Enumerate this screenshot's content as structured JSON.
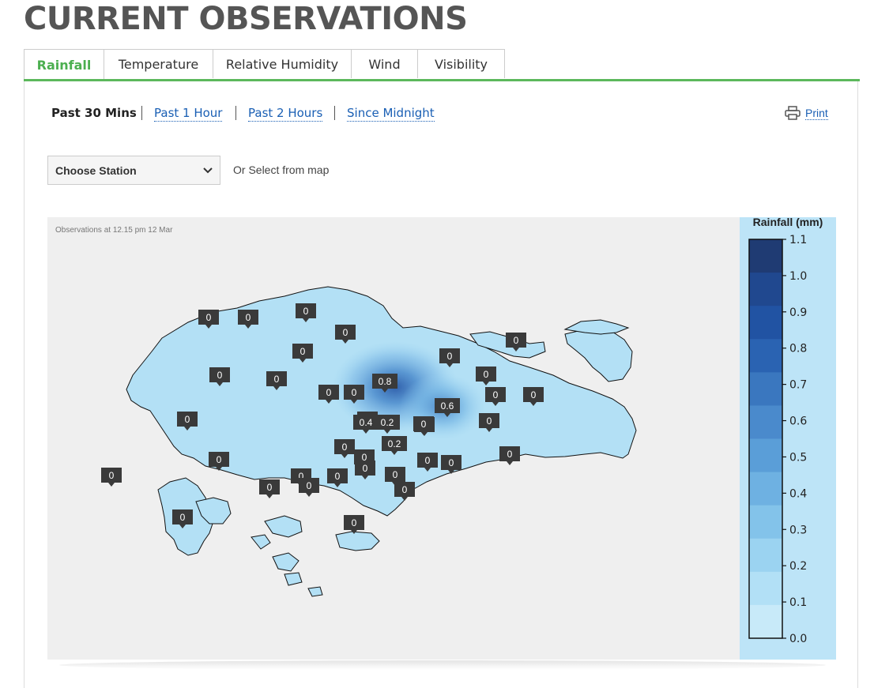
{
  "page": {
    "title": "CURRENT OBSERVATIONS"
  },
  "tabs": [
    {
      "label": "Rainfall",
      "active": true
    },
    {
      "label": "Temperature"
    },
    {
      "label": "Relative Humidity"
    },
    {
      "label": "Wind"
    },
    {
      "label": "Visibility"
    }
  ],
  "periods": [
    {
      "label": "Past 30 Mins",
      "active": true
    },
    {
      "label": "Past 1 Hour"
    },
    {
      "label": "Past 2 Hours"
    },
    {
      "label": "Since Midnight"
    }
  ],
  "print_label": "Print",
  "station_select": {
    "value": "Choose Station"
  },
  "select_hint": "Or Select from map",
  "map": {
    "observation_text": "Observations at 12.15 pm 12 Mar",
    "land_color": "#b3e0f5",
    "stations": [
      "0",
      "0",
      "0",
      "0",
      "0",
      "0",
      "0",
      "0",
      "0",
      "0",
      "0",
      "0.8",
      "0",
      "0",
      "0",
      "0",
      "0",
      "0",
      "0.6",
      "0",
      "0.4",
      "0.2",
      "0",
      "0",
      "0.2",
      "0",
      "0",
      "0",
      "0",
      "0",
      "0",
      "0",
      "0",
      "0",
      "0",
      "0",
      "0",
      "0",
      "0",
      "0"
    ]
  },
  "legend": {
    "title": "Rainfall (mm)",
    "ticks": [
      "1.1",
      "1.0",
      "0.9",
      "0.8",
      "0.7",
      "0.6",
      "0.5",
      "0.4",
      "0.3",
      "0.2",
      "0.1",
      "0.0"
    ],
    "colors": [
      "#1f3b73",
      "#20488f",
      "#2153a3",
      "#2a63b2",
      "#3a77bf",
      "#4a8acc",
      "#5a9ed8",
      "#6eb1e2",
      "#83c3ea",
      "#9bd3f1",
      "#b2e0f6",
      "#c8eaf9"
    ]
  }
}
